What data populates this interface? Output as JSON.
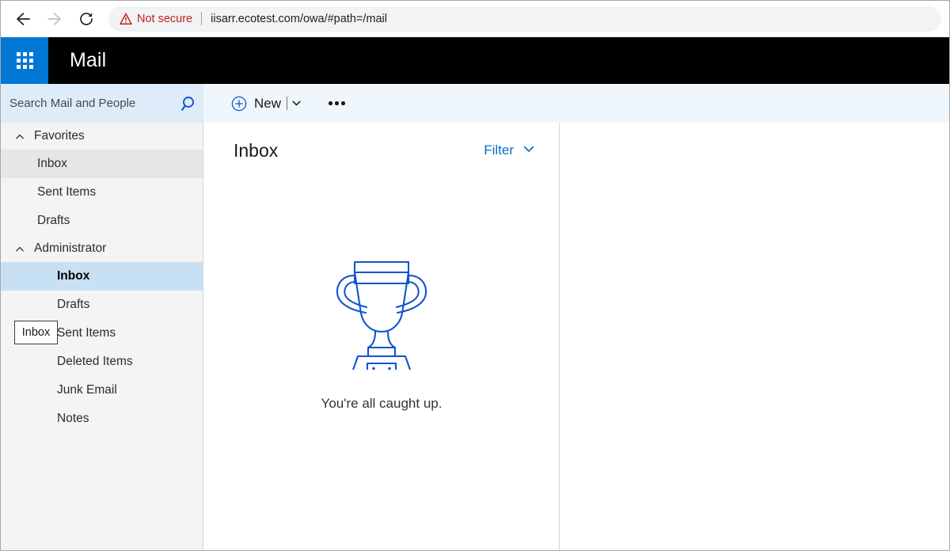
{
  "browser": {
    "back_icon": "arrow-left-icon",
    "forward_icon": "arrow-right-icon",
    "reload_icon": "reload-icon",
    "security_warning": "Not secure",
    "warning_icon": "warning-triangle-icon",
    "url": "iisarr.ecotest.com/owa/#path=/mail",
    "warning_color": "#c5221f"
  },
  "header": {
    "waffle_icon": "app-launcher-waffle-icon",
    "title": "Mail",
    "background": "#000000",
    "waffle_background": "#0078d4"
  },
  "search": {
    "placeholder": "Search Mail and People",
    "icon": "search-magnifier-icon"
  },
  "command_bar": {
    "new_icon": "circle-plus-icon",
    "new_label": "New",
    "new_dropdown_icon": "chevron-down-icon",
    "overflow_icon": "ellipsis-icon"
  },
  "sidebar": {
    "groups": [
      {
        "label": "Favorites",
        "chevron_icon": "chevron-up-icon",
        "items": [
          {
            "label": "Inbox",
            "state": "hovered"
          },
          {
            "label": "Sent Items",
            "state": "normal"
          },
          {
            "label": "Drafts",
            "state": "normal"
          }
        ]
      },
      {
        "label": "Administrator",
        "chevron_icon": "chevron-up-icon",
        "items": [
          {
            "label": "Inbox",
            "state": "selected"
          },
          {
            "label": "Drafts",
            "state": "normal"
          },
          {
            "label": "Sent Items",
            "state": "normal"
          },
          {
            "label": "Deleted Items",
            "state": "normal"
          },
          {
            "label": "Junk Email",
            "state": "normal"
          },
          {
            "label": "Notes",
            "state": "normal"
          }
        ]
      }
    ],
    "tooltip": "Inbox",
    "selected_color": "#c7e0f4",
    "hover_color": "#e6e6e6",
    "background": "#f4f4f4"
  },
  "list_pane": {
    "title": "Inbox",
    "filter_label": "Filter",
    "filter_chevron_icon": "chevron-down-icon",
    "filter_color": "#0f6cbd",
    "empty_illustration": "trophy-icon",
    "empty_message": "You're all caught up.",
    "illustration_color": "#0f55d0"
  }
}
